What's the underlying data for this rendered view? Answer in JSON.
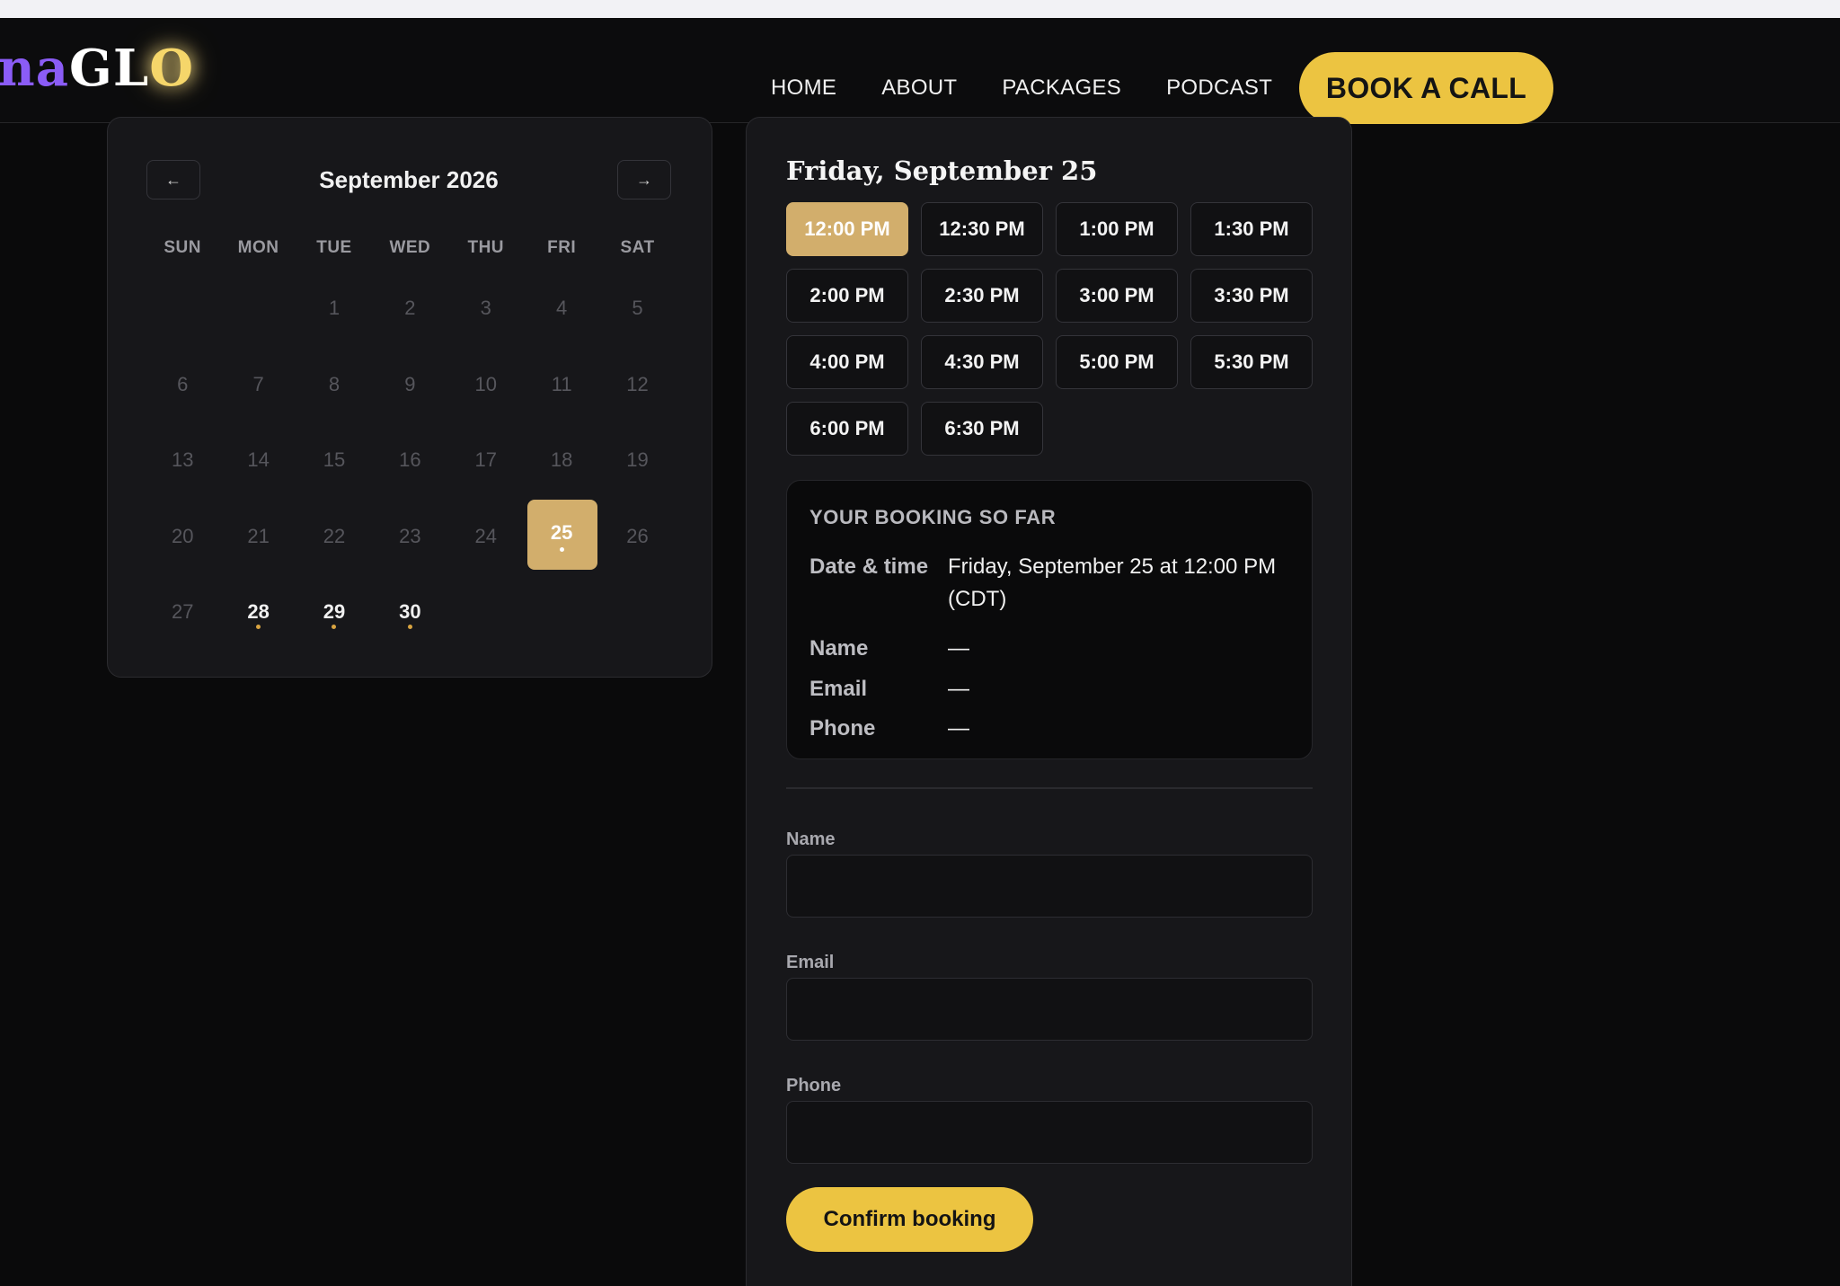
{
  "header": {
    "logo_part1": "na",
    "logo_part2": "GL",
    "logo_part3": "O",
    "nav": [
      "HOME",
      "ABOUT",
      "PACKAGES",
      "PODCAST"
    ],
    "cta_label": "BOOK A CALL"
  },
  "calendar": {
    "month_title": "September 2026",
    "prev_label": "←",
    "next_label": "→",
    "weekdays": [
      "SUN",
      "MON",
      "TUE",
      "WED",
      "THU",
      "FRI",
      "SAT"
    ],
    "leading_blanks": 2,
    "days_in_month": 30,
    "selected_day": 25,
    "available_days": [
      25,
      28,
      29,
      30
    ]
  },
  "slots": {
    "day_title": "Friday, September 25",
    "times": [
      "12:00 PM",
      "12:30 PM",
      "1:00 PM",
      "1:30 PM",
      "2:00 PM",
      "2:30 PM",
      "3:00 PM",
      "3:30 PM",
      "4:00 PM",
      "4:30 PM",
      "5:00 PM",
      "5:30 PM",
      "6:00 PM",
      "6:30 PM"
    ],
    "selected": "12:00 PM"
  },
  "summary": {
    "title": "YOUR BOOKING SO FAR",
    "datetime_label": "Date & time",
    "datetime_value": "Friday, September 25 at 12:00 PM (CDT)",
    "name_label": "Name",
    "name_value": "—",
    "email_label": "Email",
    "email_value": "—",
    "phone_label": "Phone",
    "phone_value": "—"
  },
  "form": {
    "name_label": "Name",
    "name_value": "",
    "email_label": "Email",
    "email_value": "",
    "phone_label": "Phone",
    "phone_value": "",
    "confirm_label": "Confirm booking"
  },
  "colors": {
    "accent": "#ecc441",
    "selected": "#d2ae6c",
    "available_dot": "#d9a441",
    "background": "#0a0a0b",
    "card": "#17171a"
  }
}
